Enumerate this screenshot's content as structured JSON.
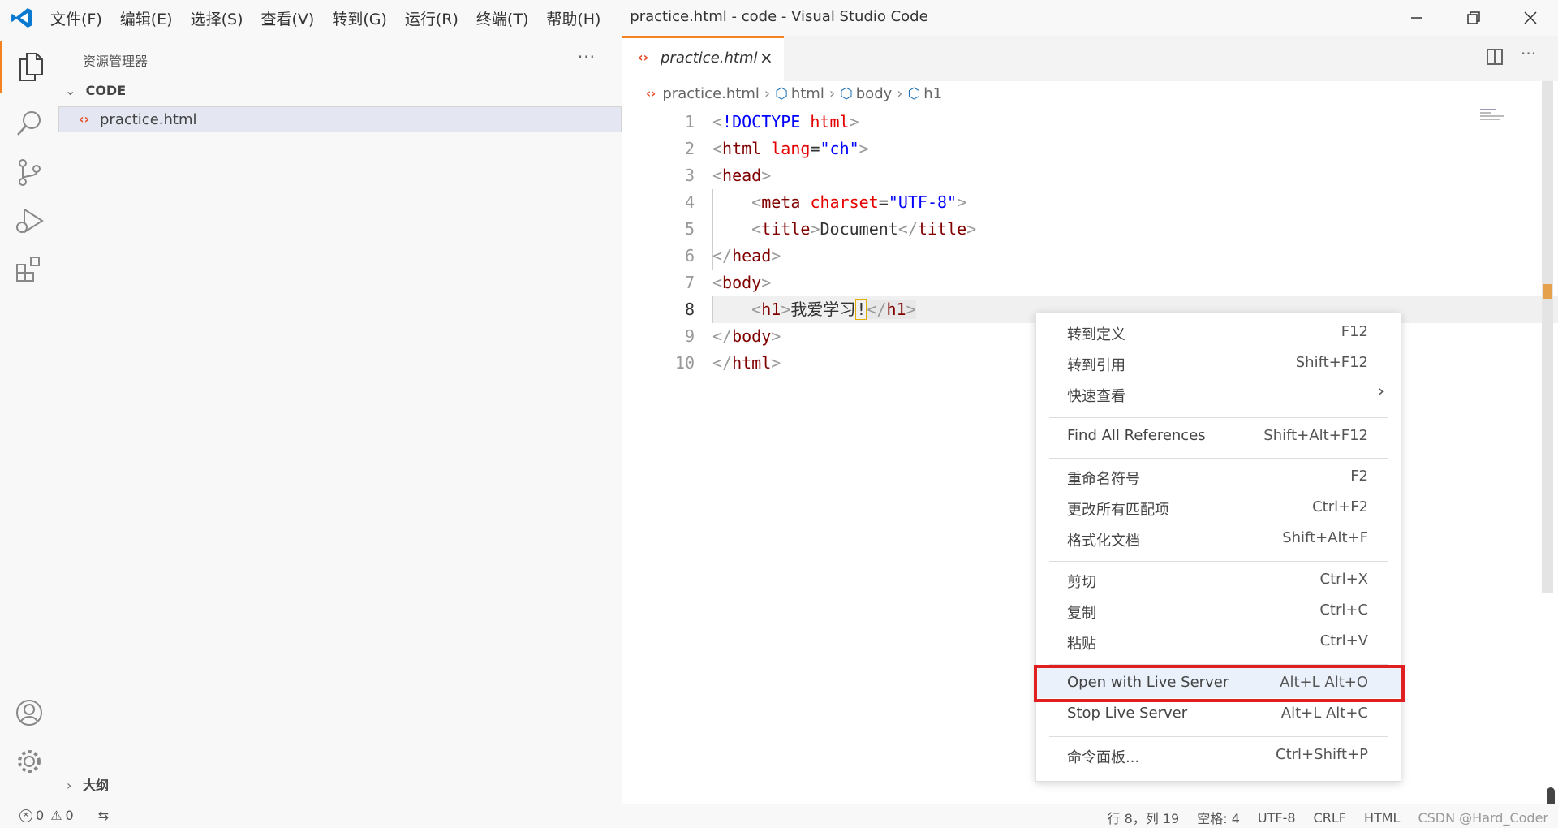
{
  "window": {
    "title": "practice.html - code - Visual Studio Code"
  },
  "menu": [
    "文件(F)",
    "编辑(E)",
    "选择(S)",
    "查看(V)",
    "转到(G)",
    "运行(R)",
    "终端(T)",
    "帮助(H)"
  ],
  "sidebar": {
    "title": "资源管理器",
    "more": "···",
    "section": "CODE",
    "file": "practice.html",
    "outline": "大纲"
  },
  "editor": {
    "tab": {
      "label": "practice.html",
      "close": "×"
    },
    "breadcrumb": [
      "practice.html",
      "html",
      "body",
      "h1"
    ],
    "line_numbers": [
      "1",
      "2",
      "3",
      "4",
      "5",
      "6",
      "7",
      "8",
      "9",
      "10"
    ]
  },
  "context_menu": [
    {
      "label": "转到定义",
      "key": "F12"
    },
    {
      "label": "转到引用",
      "key": "Shift+F12"
    },
    {
      "label": "快速查看",
      "key": "›"
    },
    {
      "label": "Find All References",
      "key": "Shift+Alt+F12"
    },
    {
      "label": "重命名符号",
      "key": "F2"
    },
    {
      "label": "更改所有匹配项",
      "key": "Ctrl+F2"
    },
    {
      "label": "格式化文档",
      "key": "Shift+Alt+F"
    },
    {
      "label": "剪切",
      "key": "Ctrl+X"
    },
    {
      "label": "复制",
      "key": "Ctrl+C"
    },
    {
      "label": "粘贴",
      "key": "Ctrl+V"
    },
    {
      "label": "Open with Live Server",
      "key": "Alt+L Alt+O"
    },
    {
      "label": "Stop Live Server",
      "key": "Alt+L Alt+C"
    },
    {
      "label": "命令面板...",
      "key": "Ctrl+Shift+P"
    }
  ],
  "status": {
    "errors": "0",
    "warnings": "0",
    "position": "行 8，列 19",
    "spaces": "空格: 4",
    "encoding": "UTF-8",
    "eol": "CRLF",
    "language": "HTML",
    "watermark": "CSDN @Hard_Coder"
  }
}
